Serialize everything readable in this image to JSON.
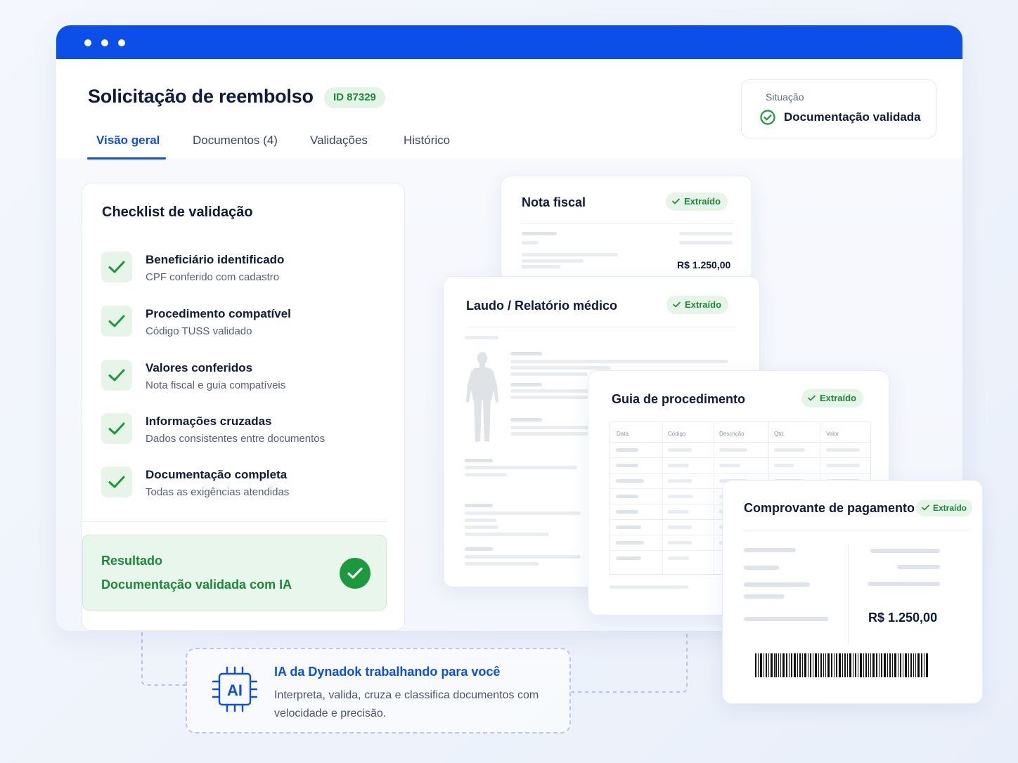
{
  "header": {
    "title": "Solicitação de reembolso",
    "id_badge": "ID 87329"
  },
  "tabs": [
    {
      "label": "Visão geral",
      "active": true
    },
    {
      "label": "Documentos (4)",
      "active": false
    },
    {
      "label": "Validações",
      "active": false
    },
    {
      "label": "Histórico",
      "active": false
    }
  ],
  "status": {
    "label": "Situação",
    "value": "Documentação validada"
  },
  "checklist": {
    "title": "Checklist de validação",
    "items": [
      {
        "title": "Beneficiário identificado",
        "subtitle": "CPF conferido com cadastro"
      },
      {
        "title": "Procedimento compatível",
        "subtitle": "Código TUSS validado"
      },
      {
        "title": "Valores conferidos",
        "subtitle": "Nota fiscal e guia compatíveis"
      },
      {
        "title": "Informações cruzadas",
        "subtitle": "Dados consistentes entre documentos"
      },
      {
        "title": "Documentação completa",
        "subtitle": "Todas as exigências atendidas"
      }
    ],
    "result": {
      "label": "Resultado",
      "value": "Documentação validada com IA"
    }
  },
  "documents": {
    "nota_fiscal": {
      "title": "Nota fiscal",
      "badge": "Extraído",
      "amount": "R$ 1.250,00"
    },
    "laudo": {
      "title": "Laudo / Relatório médico",
      "badge": "Extraído"
    },
    "guia": {
      "title": "Guia de procedimento",
      "badge": "Extraído",
      "columns": [
        "Data",
        "Código",
        "Descrição",
        "Qtd.",
        "Valor"
      ]
    },
    "comprovante": {
      "title": "Comprovante de pagamento",
      "badge": "Extraído",
      "amount": "R$ 1.250,00"
    }
  },
  "ai_panel": {
    "title": "IA da Dynadok trabalhando para você",
    "description": "Interpreta, valida, cruza e classifica documentos com velocidade e precisão.",
    "icon_text": "AI"
  },
  "colors": {
    "brand": "#0b4fe8",
    "success": "#1a8a35",
    "success_bg": "#e6f5e8"
  }
}
